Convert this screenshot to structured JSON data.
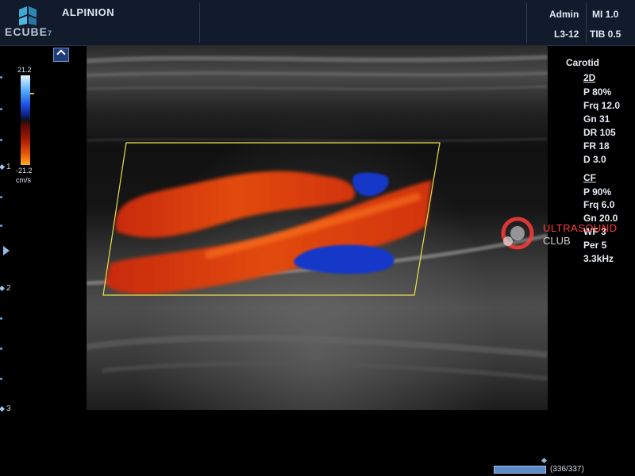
{
  "header": {
    "logo_text": "ECUBE",
    "logo_superscript": "7",
    "brand": "ALPINION",
    "user": "Admin",
    "probe": "L3-12",
    "mi": "MI 1.0",
    "tib": "TIB 0.5"
  },
  "colorbar": {
    "max_label": "21.2",
    "min_label": "-21.2",
    "unit": "cm/s"
  },
  "depth_marks": [
    "1",
    "2",
    "3"
  ],
  "right_panel": {
    "preset": "Carotid",
    "mode_2d": {
      "heading": "2D",
      "items": [
        "P 80%",
        "Frq 12.0",
        "Gn 31",
        "DR 105",
        "FR 18",
        "D 3.0"
      ]
    },
    "mode_cf": {
      "heading": "CF",
      "items": [
        "P 90%",
        "Frq 6.0",
        "Gn 20.0",
        "WF 3",
        "Per 5",
        "3.3kHz"
      ]
    }
  },
  "watermark": {
    "line1": "ULTRASOUND",
    "line2": "CLUB"
  },
  "cine": {
    "frame_text": "(336/337)",
    "progress_fraction": 0.997
  },
  "colors": {
    "header_bg": "#111b2b",
    "roi_box": "#e8e04a",
    "flow_red": "#d8330a",
    "flow_blue": "#1838c8",
    "accent_blue": "#5b8ac7"
  }
}
